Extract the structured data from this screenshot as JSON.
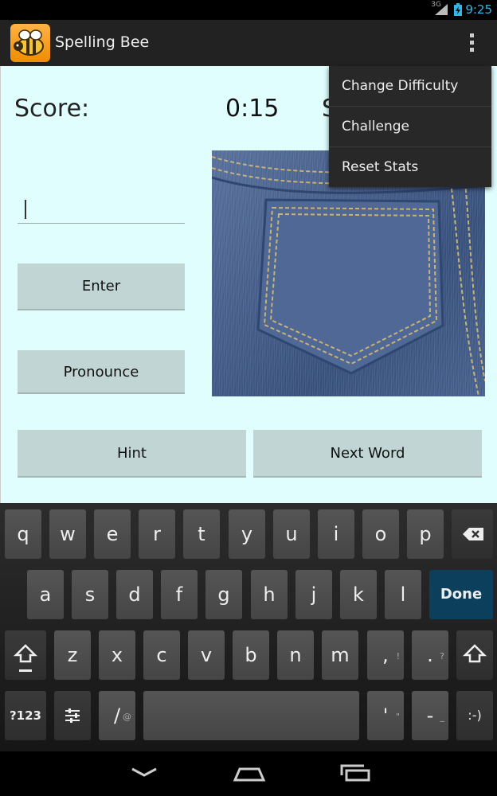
{
  "status_bar": {
    "network": "3G",
    "time": "9:25"
  },
  "action_bar": {
    "title": "Spelling Bee",
    "overflow_icon": "overflow-menu-icon"
  },
  "game": {
    "score_label": "Score:",
    "timer": "0:15",
    "stats_label_partial": "S",
    "input_value": "",
    "enter_label": "Enter",
    "pronounce_label": "Pronounce",
    "hint_label": "Hint",
    "next_word_label": "Next Word",
    "image": "denim-jeans-pocket"
  },
  "menu": {
    "items": [
      {
        "label": "Change Difficulty"
      },
      {
        "label": "Challenge"
      },
      {
        "label": "Reset Stats"
      }
    ]
  },
  "keyboard": {
    "row1": [
      "q",
      "w",
      "e",
      "r",
      "t",
      "y",
      "u",
      "i",
      "o",
      "p"
    ],
    "row2": [
      "a",
      "s",
      "d",
      "f",
      "g",
      "h",
      "j",
      "k",
      "l"
    ],
    "row3": [
      "z",
      "x",
      "c",
      "v",
      "b",
      "n",
      "m",
      ",",
      "."
    ],
    "row3_hints": [
      "!",
      "?"
    ],
    "symbols_label": "?123",
    "slash_label": "/",
    "slash_hint": "@",
    "apostrophe_label": "'",
    "apostrophe_hint": "\"",
    "dash_label": "-",
    "dash_hint": "_",
    "smiley_label": ":-)",
    "done_label": "Done",
    "accent_color": "#0c3f5b"
  },
  "colors": {
    "content_bg": "#e0fefe",
    "button_bg": "#c1d6d4",
    "time_color": "#33b5e5"
  }
}
